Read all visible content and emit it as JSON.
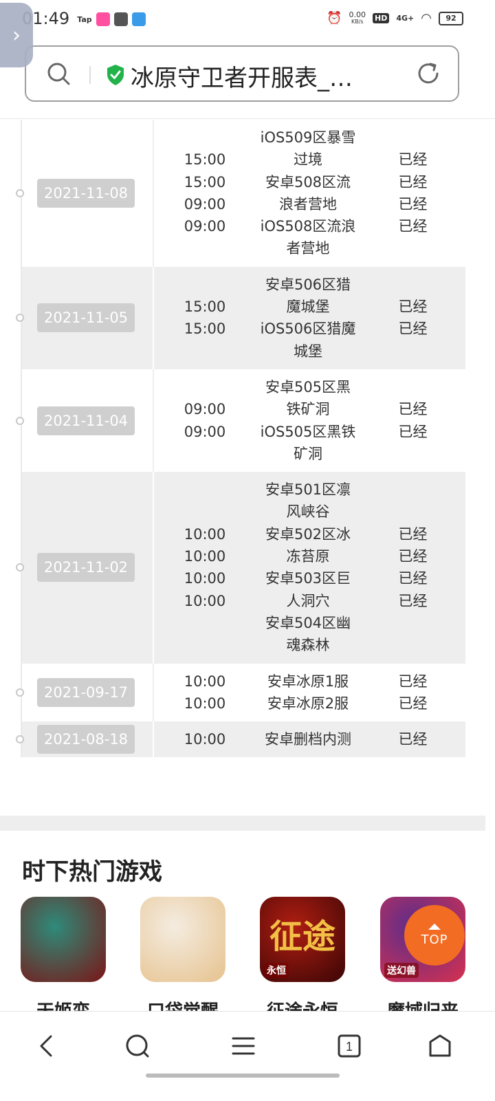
{
  "status_bar": {
    "time": "01:49",
    "tap_label": "Tap",
    "net_speed_top": "0.00",
    "net_speed_unit": "KB/s",
    "hd": "HD",
    "network": "4G+",
    "battery": "92"
  },
  "url_bar": {
    "title": "冰原守卫者开服表_…"
  },
  "schedule": [
    {
      "date": "2021-11-08",
      "times": [
        "15:00",
        "15:00",
        "09:00",
        "09:00"
      ],
      "names": [
        "iOS509区暴雪",
        "过境",
        "安卓508区流",
        "浪者营地",
        "iOS508区流浪",
        "者营地"
      ],
      "statuses": [
        "已经",
        "已经",
        "已经",
        "已经"
      ]
    },
    {
      "date": "2021-11-05",
      "times": [
        "15:00",
        "15:00"
      ],
      "names": [
        "安卓506区猎",
        "魔城堡",
        "iOS506区猎魔",
        "城堡"
      ],
      "statuses": [
        "已经",
        "已经"
      ]
    },
    {
      "date": "2021-11-04",
      "times": [
        "09:00",
        "09:00"
      ],
      "names": [
        "安卓505区黑",
        "铁矿洞",
        "iOS505区黑铁",
        "矿洞"
      ],
      "statuses": [
        "已经",
        "已经"
      ]
    },
    {
      "date": "2021-11-02",
      "times": [
        "10:00",
        "10:00",
        "10:00",
        "10:00"
      ],
      "names": [
        "安卓501区凛",
        "风峡谷",
        "安卓502区冰",
        "冻苔原",
        "安卓503区巨",
        "人洞穴",
        "安卓504区幽",
        "魂森林"
      ],
      "statuses": [
        "已经",
        "已经",
        "已经",
        "已经"
      ]
    },
    {
      "date": "2021-09-17",
      "times": [
        "10:00",
        "10:00"
      ],
      "names": [
        "安卓冰原1服",
        "安卓冰原2服"
      ],
      "statuses": [
        "已经",
        "已经"
      ]
    },
    {
      "date": "2021-08-18",
      "times": [
        "10:00"
      ],
      "names": [
        "安卓删档内测"
      ],
      "statuses": [
        "已经"
      ]
    }
  ],
  "hot_games": {
    "title": "时下热门游戏",
    "items": [
      {
        "name": "天姬变",
        "colors": [
          "#7a1515",
          "#2e8b7a"
        ]
      },
      {
        "name": "口袋觉醒",
        "colors": [
          "#e6c28e",
          "#f4ece0"
        ]
      },
      {
        "name": "征途永恒",
        "colors": [
          "#3a0505",
          "#b01e12"
        ],
        "icon_text": "征途",
        "badge": "永恒"
      },
      {
        "name": "魔域归来",
        "colors": [
          "#d8304e",
          "#5b2e8c"
        ],
        "badge": "送幻兽"
      }
    ]
  },
  "top_button": {
    "label": "TOP"
  }
}
